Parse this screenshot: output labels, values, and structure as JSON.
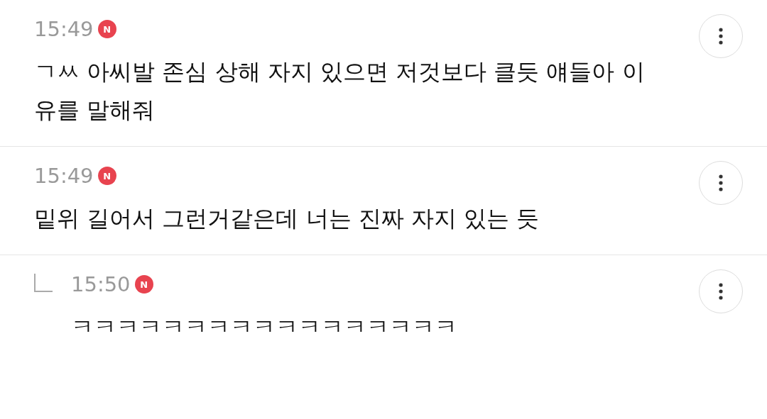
{
  "comments": [
    {
      "kind": "comment",
      "time": "15:49",
      "badge": "N",
      "text": "ㄱㅆ 아씨발 존심 상해 자지 있으면 저것보다 클듯 얘들아 이유를 말해줘"
    },
    {
      "kind": "comment",
      "time": "15:49",
      "badge": "N",
      "text": "밑위 길어서 그런거같은데 너는 진짜 자지 있는 듯"
    },
    {
      "kind": "reply",
      "time": "15:50",
      "badge": "N",
      "text": "ㅋㅋㅋㅋㅋㅋㅋㅋㅋㅋㅋㅋㅋㅋㅋㅋㅋ"
    }
  ]
}
